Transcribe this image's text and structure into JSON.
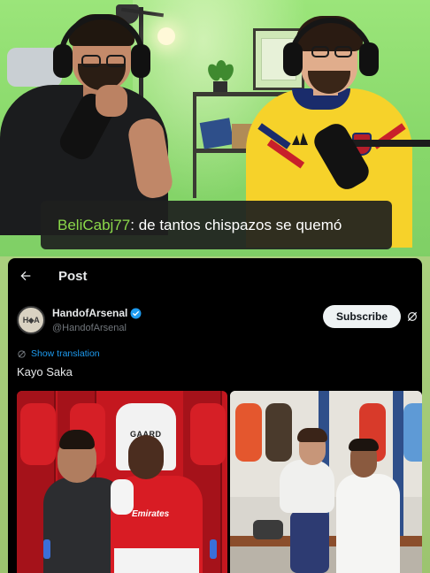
{
  "stream": {
    "chat": {
      "username": "BeliCabj77",
      "separator": ": ",
      "message": "de tantos chispazos se quemó",
      "username_color": "#8bd84a"
    }
  },
  "post_view": {
    "header": {
      "title": "Post",
      "back_icon": "arrow-left-icon"
    },
    "author": {
      "display_name": "HandofArsenal",
      "handle": "@HandofArsenal",
      "avatar_initials": "H◆A",
      "verified": true,
      "verified_color": "#1d9bf0"
    },
    "subscribe_label": "Subscribe",
    "show_translation_label": "Show translation",
    "text": "Kayo Saka",
    "media": [
      {
        "description": "photo-locker-room-red",
        "shirt_text": "GAARD",
        "sponsor_text": "Emirates"
      },
      {
        "description": "photo-locker-room-white"
      }
    ],
    "colors": {
      "background": "#000000",
      "text": "#e7e9ea",
      "secondary_text": "#71767b",
      "link": "#1d9bf0"
    }
  }
}
